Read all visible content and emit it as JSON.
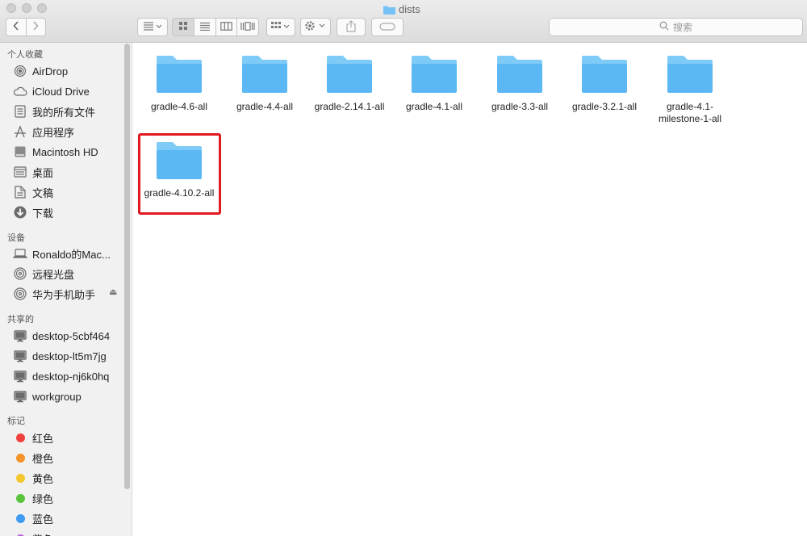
{
  "window": {
    "title": "dists"
  },
  "search": {
    "placeholder": "搜索"
  },
  "sidebar": {
    "favorites_header": "个人收藏",
    "favorites": [
      {
        "label": "AirDrop",
        "icon": "airdrop-icon"
      },
      {
        "label": "iCloud Drive",
        "icon": "cloud-icon"
      },
      {
        "label": "我的所有文件",
        "icon": "all-files-icon"
      },
      {
        "label": "应用程序",
        "icon": "applications-icon"
      },
      {
        "label": "Macintosh HD",
        "icon": "hard-drive-icon"
      },
      {
        "label": "桌面",
        "icon": "desktop-icon"
      },
      {
        "label": "文稿",
        "icon": "documents-icon"
      },
      {
        "label": "下载",
        "icon": "downloads-icon"
      }
    ],
    "devices_header": "设备",
    "devices": [
      {
        "label": "Ronaldo的Mac...",
        "icon": "laptop-icon"
      },
      {
        "label": "远程光盘",
        "icon": "disc-icon"
      },
      {
        "label": "华为手机助手",
        "icon": "disc-icon",
        "eject": "⏏"
      }
    ],
    "shared_header": "共享的",
    "shared": [
      {
        "label": "desktop-5cbf464",
        "icon": "monitor-icon"
      },
      {
        "label": "desktop-lt5m7jg",
        "icon": "monitor-icon"
      },
      {
        "label": "desktop-nj6k0hq",
        "icon": "monitor-icon"
      },
      {
        "label": "workgroup",
        "icon": "monitor-icon"
      }
    ],
    "tags_header": "标记",
    "tags": [
      {
        "label": "红色",
        "color": "#f0403d"
      },
      {
        "label": "橙色",
        "color": "#f6932a"
      },
      {
        "label": "黄色",
        "color": "#f5c72f"
      },
      {
        "label": "绿色",
        "color": "#57c43b"
      },
      {
        "label": "蓝色",
        "color": "#3f9af1"
      },
      {
        "label": "紫色",
        "color": "#b865d5"
      }
    ]
  },
  "files": [
    {
      "name": "gradle-4.6-all"
    },
    {
      "name": "gradle-4.4-all"
    },
    {
      "name": "gradle-2.14.1-all"
    },
    {
      "name": "gradle-4.1-all"
    },
    {
      "name": "gradle-3.3-all"
    },
    {
      "name": "gradle-3.2.1-all"
    },
    {
      "name": "gradle-4.1-milestone-1-all"
    },
    {
      "name": "gradle-4.10.2-all",
      "highlighted": true
    }
  ],
  "colors": {
    "folder": "#5bb8f4",
    "folder_tab": "#7fcbf8",
    "highlight": "#e0181f"
  }
}
